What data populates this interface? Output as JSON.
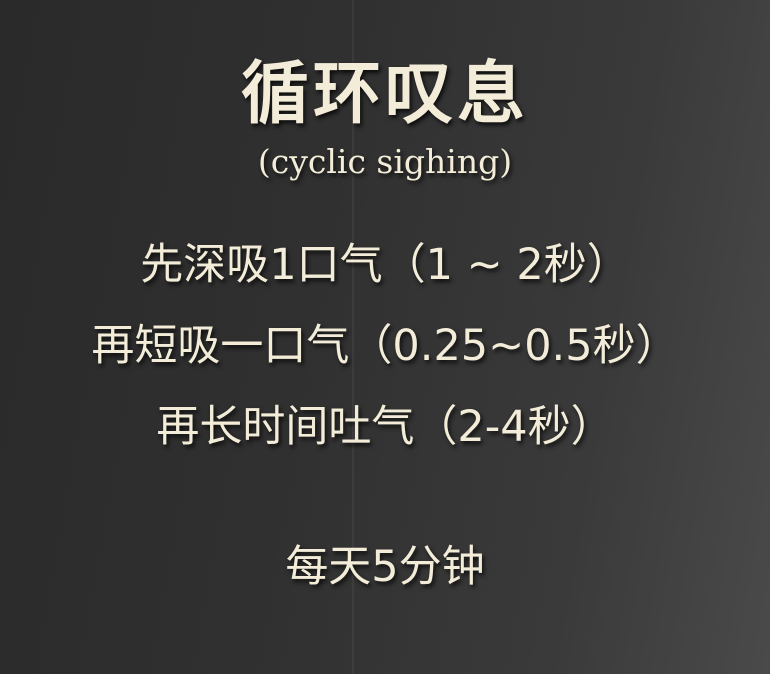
{
  "slide": {
    "title": "循环叹息",
    "subtitle": "(cyclic sighing)",
    "steps": [
      "先深吸1口气（1 ~ 2秒）",
      "再短吸一口气（0.25~0.5秒）",
      "再长时间吐气（2-4秒）"
    ],
    "daily": "每天5分钟"
  }
}
